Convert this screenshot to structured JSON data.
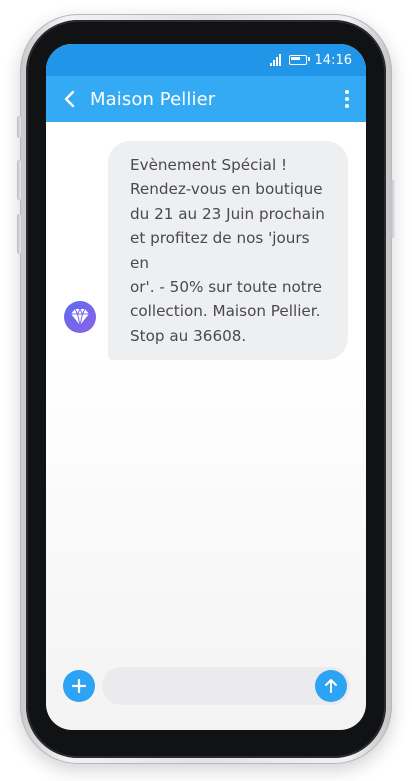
{
  "status_bar": {
    "time": "14:16",
    "signal_icon": "signal-icon",
    "battery_icon": "battery-icon"
  },
  "header": {
    "title": "Maison Pellier",
    "back_icon": "chevron-left-icon",
    "menu_icon": "more-vert-icon"
  },
  "message": {
    "avatar_icon": "diamond-icon",
    "text": "Evènement Spécial !\nRendez-vous en boutique\ndu 21 au 23 Juin prochain\net profitez de nos 'jours en\nor'. - 50% sur toute notre\ncollection. Maison Pellier.\nStop au 36608."
  },
  "composer": {
    "add_icon": "plus-icon",
    "send_icon": "arrow-up-icon",
    "input_value": "",
    "input_placeholder": ""
  },
  "colors": {
    "status_bar": "#2196e8",
    "header": "#33aaf3",
    "accent": "#2da3f3",
    "bubble": "#eeeff1",
    "avatar_start": "#5c6cf0",
    "avatar_end": "#8a63e6"
  }
}
